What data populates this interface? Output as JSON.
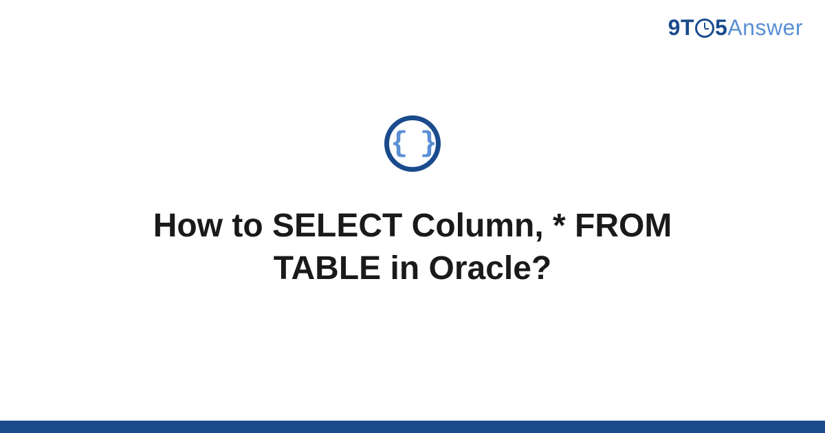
{
  "logo": {
    "prefix": "9T",
    "middle": "5",
    "suffix": "Answer"
  },
  "icon": {
    "name": "code-braces-icon",
    "glyph": "{ }"
  },
  "title": "How to SELECT Column, * FROM TABLE in Oracle?",
  "colors": {
    "primary": "#1a4b8c",
    "secondary": "#5a8fd4",
    "text": "#1a1a1a"
  }
}
